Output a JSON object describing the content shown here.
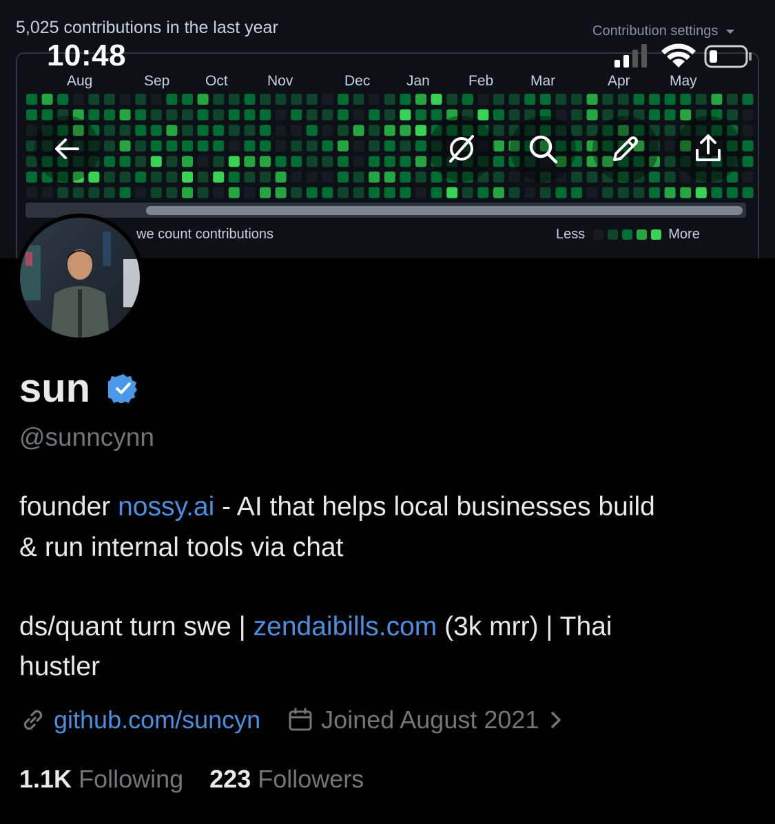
{
  "banner": {
    "contributions_title": "5,025 contributions in the last year",
    "settings_label": "Contribution settings",
    "months": [
      "Aug",
      "Sep",
      "Oct",
      "Nov",
      "Dec",
      "Jan",
      "Feb",
      "Mar",
      "Apr",
      "May"
    ],
    "how_we_count": "we count contributions",
    "legend_less": "Less",
    "legend_more": "More",
    "levels": [
      "#161b22",
      "#0e4429",
      "#006d32",
      "#26a641",
      "#39d353"
    ]
  },
  "status_bar": {
    "time": "10:48"
  },
  "nav_icons": [
    "back-arrow-icon",
    "grok-icon",
    "search-icon",
    "edit-icon",
    "share-icon"
  ],
  "profile": {
    "name": "sun",
    "handle": "@sunncynn",
    "bio_line1_pre": "founder ",
    "bio_line1_link": "nossy.ai",
    "bio_line1_post": " - AI that helps local businesses build",
    "bio_line2": "& run internal tools via chat",
    "bio_line3_pre": "ds/quant turn swe | ",
    "bio_line3_link": "zendaibills.com",
    "bio_line3_post": " (3k mrr) | Thai",
    "bio_line4": "hustler",
    "website": "github.com/suncyn",
    "joined": "Joined August 2021",
    "following_count": "1.1K",
    "following_label": "Following",
    "followers_count": "223",
    "followers_label": "Followers"
  }
}
